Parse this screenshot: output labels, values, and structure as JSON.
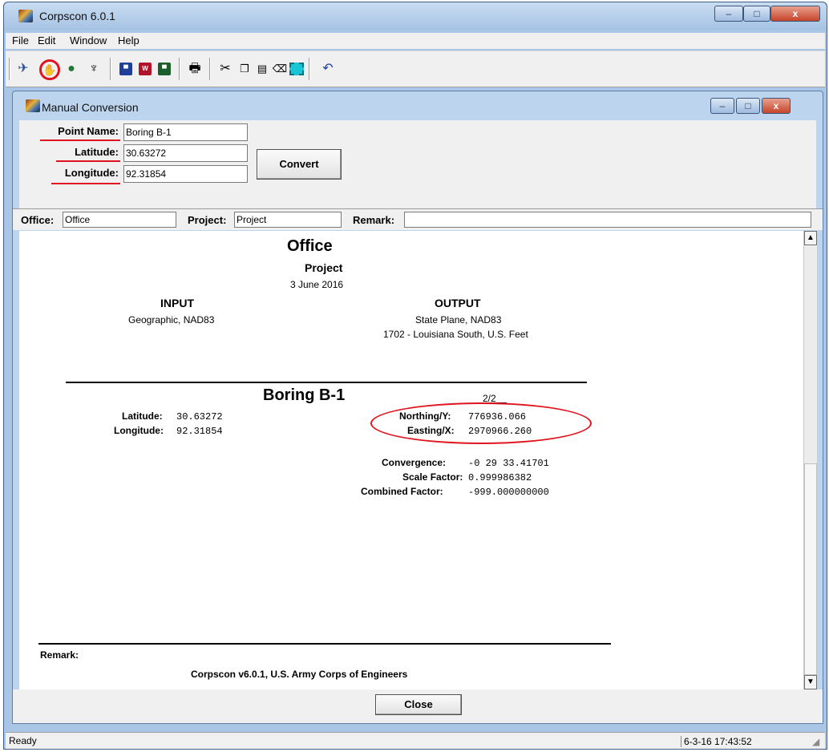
{
  "window": {
    "title": "Corpscon 6.0.1",
    "minimize": "–",
    "maximize": "□",
    "close": "x"
  },
  "menu": [
    "File",
    "Edit",
    "Window",
    "Help"
  ],
  "child": {
    "title": "Manual Conversion"
  },
  "form": {
    "point_name_label": "Point Name:",
    "point_name_value": "Boring B-1",
    "latitude_label": "Latitude:",
    "latitude_value": "30.63272",
    "longitude_label": "Longitude:",
    "longitude_value": "92.31854",
    "convert_label": "Convert",
    "office_label": "Office:",
    "office_value": "Office",
    "project_label": "Project:",
    "project_value": "Project",
    "remark_label": "Remark:",
    "remark_value": ""
  },
  "report": {
    "office": "Office",
    "project": "Project",
    "date": "3 June 2016",
    "input_heading": "INPUT",
    "input_desc": "Geographic, NAD83",
    "output_heading": "OUTPUT",
    "output_desc1": "State Plane, NAD83",
    "output_desc2": "1702 - Louisiana South, U.S. Feet",
    "point_title": "Boring B-1",
    "page": "2/2",
    "lat_label": "Latitude:",
    "lat_value": "30.63272",
    "lon_label": "Longitude:",
    "lon_value": "92.31854",
    "northing_label": "Northing/Y:",
    "northing_value": "776936.066",
    "easting_label": "Easting/X:",
    "easting_value": "2970966.260",
    "convergence_label": "Convergence:",
    "convergence_value": "-0 29 33.41701",
    "scale_label": "Scale Factor:",
    "scale_value": "0.999986382",
    "combined_label": "Combined Factor:",
    "combined_value": "-999.000000000",
    "remark_label": "Remark:",
    "footer": "Corpscon v6.0.1, U.S. Army Corps of Engineers"
  },
  "close_button": "Close",
  "status": {
    "left": "Ready",
    "right": "6-3-16 17:43:52"
  },
  "colors": {
    "annotation_red": "#e0141e",
    "title_blue": "#a9c6e6"
  }
}
